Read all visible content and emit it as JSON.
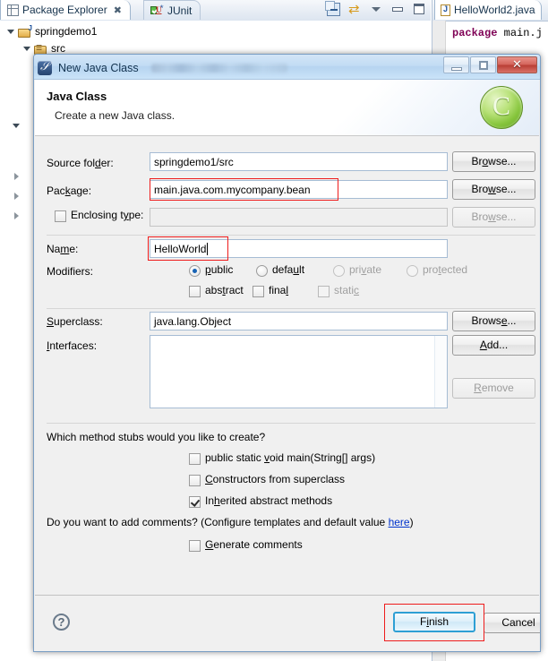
{
  "ide": {
    "tabs": [
      {
        "label": "Package Explorer",
        "icon": "package-explorer-icon",
        "close": "✖",
        "active": true
      },
      {
        "label": "JUnit",
        "icon": "junit-icon",
        "active": false
      }
    ],
    "toolbar_icons": [
      "collapse-all-icon",
      "link-with-editor-icon",
      "view-menu-icon",
      "minimize-icon",
      "maximize-icon"
    ],
    "tree": [
      {
        "label": "springdemo1",
        "icon": "java-project-icon",
        "expanded": true
      },
      {
        "label": "src",
        "icon": "source-folder-icon",
        "expanded": true
      }
    ],
    "editor": {
      "tab_label": "HelloWorld2.java",
      "tab_icon": "java-file-icon",
      "code_keyword": "package",
      "code_rest": " main.j"
    }
  },
  "dialog": {
    "title": "New Java Class",
    "icon": "new-java-class-icon",
    "window_controls": {
      "minimize": "minimize-button",
      "maximize": "maximize-button",
      "close_glyph": "✕"
    },
    "header": {
      "title": "Java Class",
      "subtitle": "Create a new Java class.",
      "badge": "C"
    },
    "fields": {
      "source_folder": {
        "label": "Source folder:",
        "label_pre": "Source fol",
        "label_key": "d",
        "label_post": "er:",
        "value": "springdemo1/src",
        "browse": "Browse...",
        "browse_pre": "Br",
        "browse_key": "o",
        "browse_post": "wse..."
      },
      "package": {
        "label": "Package:",
        "label_pre": "Pac",
        "label_key": "k",
        "label_post": "age:",
        "value": "main.java.com.mycompany.bean",
        "browse": "Browse...",
        "browse_pre": "Bro",
        "browse_key": "w",
        "browse_post": "se...",
        "annotated": true
      },
      "enclosing_type": {
        "label": "Enclosing type:",
        "label_pre": "Enclosing t",
        "label_key": "y",
        "label_post": "pe:",
        "value": "",
        "checked": false,
        "browse": "Browse...",
        "browse_pre": "Bro",
        "browse_key": "w",
        "browse_post": "se...",
        "disabled": true
      },
      "name": {
        "label": "Name:",
        "label_pre": "Na",
        "label_key": "m",
        "label_post": "e:",
        "value": "HelloWorld",
        "annotated": true,
        "caret": true
      },
      "modifiers": {
        "label": "Modifiers:",
        "radios": [
          {
            "label": "public",
            "pre": "",
            "key": "p",
            "post": "ublic",
            "selected": true,
            "enabled": true
          },
          {
            "label": "default",
            "pre": "defa",
            "key": "u",
            "post": "lt",
            "selected": false,
            "enabled": true
          },
          {
            "label": "private",
            "pre": "pri",
            "key": "v",
            "post": "ate",
            "selected": false,
            "enabled": false
          },
          {
            "label": "protected",
            "pre": "pro",
            "key": "t",
            "post": "ected",
            "selected": false,
            "enabled": false
          }
        ],
        "checkboxes": [
          {
            "label": "abstract",
            "pre": "abs",
            "key": "t",
            "post": "ract",
            "checked": false,
            "enabled": true
          },
          {
            "label": "final",
            "pre": "fina",
            "key": "l",
            "post": "",
            "checked": false,
            "enabled": true
          },
          {
            "label": "static",
            "pre": "stati",
            "key": "c",
            "post": "",
            "checked": false,
            "enabled": false
          }
        ]
      },
      "superclass": {
        "label": "Superclass:",
        "label_pre": "",
        "label_key": "S",
        "label_post": "uperclass:",
        "value": "java.lang.Object",
        "browse": "Browse...",
        "browse_pre": "Brows",
        "browse_key": "e",
        "browse_post": "..."
      },
      "interfaces": {
        "label": "Interfaces:",
        "label_pre": "",
        "label_key": "I",
        "label_post": "nterfaces:",
        "items": [],
        "add": "Add...",
        "add_pre": "",
        "add_key": "A",
        "add_post": "dd...",
        "remove": "Remove",
        "remove_pre": "",
        "remove_key": "R",
        "remove_post": "emove",
        "remove_disabled": true
      },
      "method_stubs": {
        "question": "Which method stubs would you like to create?",
        "options": [
          {
            "label": "public static void main(String[] args)",
            "pre": "public static ",
            "key": "v",
            "post": "oid main(String[] args)",
            "checked": false
          },
          {
            "label": "Constructors from superclass",
            "pre": "",
            "key": "C",
            "post": "onstructors from superclass",
            "checked": false
          },
          {
            "label": "Inherited abstract methods",
            "pre": "In",
            "key": "h",
            "post": "erited abstract methods",
            "checked": true
          }
        ]
      },
      "comments": {
        "question_pre": "Do you want to add comments? (Configure templates and default value ",
        "link": "here",
        "question_post": ")",
        "option": {
          "label": "Generate comments",
          "pre": "",
          "key": "G",
          "post": "enerate comments",
          "checked": false
        }
      }
    },
    "footer": {
      "help": "?",
      "finish": "Finish",
      "finish_pre": "F",
      "finish_key": "i",
      "finish_post": "nish",
      "finish_annotated": true,
      "cancel": "Cancel"
    }
  },
  "colors": {
    "annotation": "#ee1c1c",
    "default_button_border": "#2e9fd4",
    "link": "#0033cc",
    "badge_green": "#86c53c",
    "keyword": "#7f0055"
  }
}
